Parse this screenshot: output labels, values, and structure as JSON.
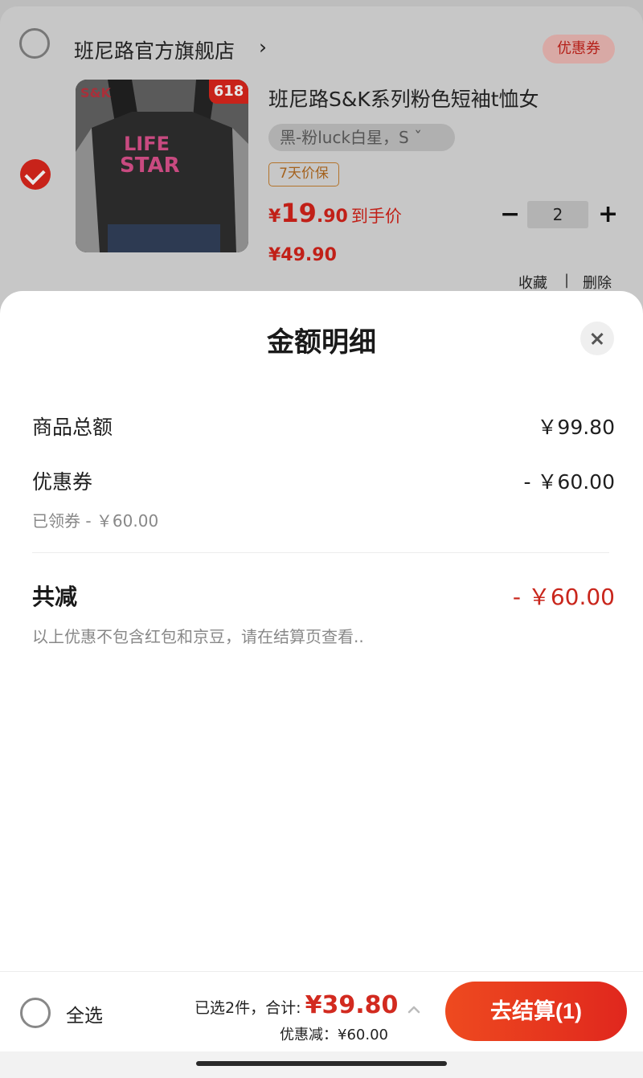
{
  "cart": {
    "store_name": "班尼路官方旗舰店",
    "store_chevron": "›",
    "coupon_badge": "优惠券",
    "item": {
      "image_brand": "S&K",
      "image_tag": "618",
      "title": "班尼路S&K系列粉色短袖t恤女",
      "variant": "黑-粉luck白星，S ˇ",
      "guarantee": "7天价保",
      "price_yen": "¥",
      "price_int": "19",
      "price_dec": ".90",
      "price_label": "到手价",
      "original_price": "¥49.90",
      "quantity": "2",
      "qty_minus": "−",
      "qty_plus": "+",
      "favorite": "收藏",
      "separator": "|",
      "delete": "删除",
      "checked": true
    }
  },
  "sheet": {
    "title": "金额明细",
    "rows": [
      {
        "label": "商品总额",
        "value": "￥99.80"
      },
      {
        "label": "优惠券",
        "value": "- ￥60.00",
        "note": "已领券 - ￥60.00"
      }
    ],
    "total": {
      "label": "共减",
      "value": "- ￥60.00"
    },
    "hint": "以上优惠不包含红包和京豆，请在结算页查看.."
  },
  "bottom_bar": {
    "select_all": "全选",
    "selected_label": "已选2件，合计:",
    "total_amount": "¥39.80",
    "discount": "优惠减：¥60.00",
    "checkout": "去结算(1)"
  },
  "colors": {
    "accent_red": "#c9261c",
    "checkout_gradient_start": "#ee4a1f",
    "checkout_gradient_end": "#e0271e"
  }
}
